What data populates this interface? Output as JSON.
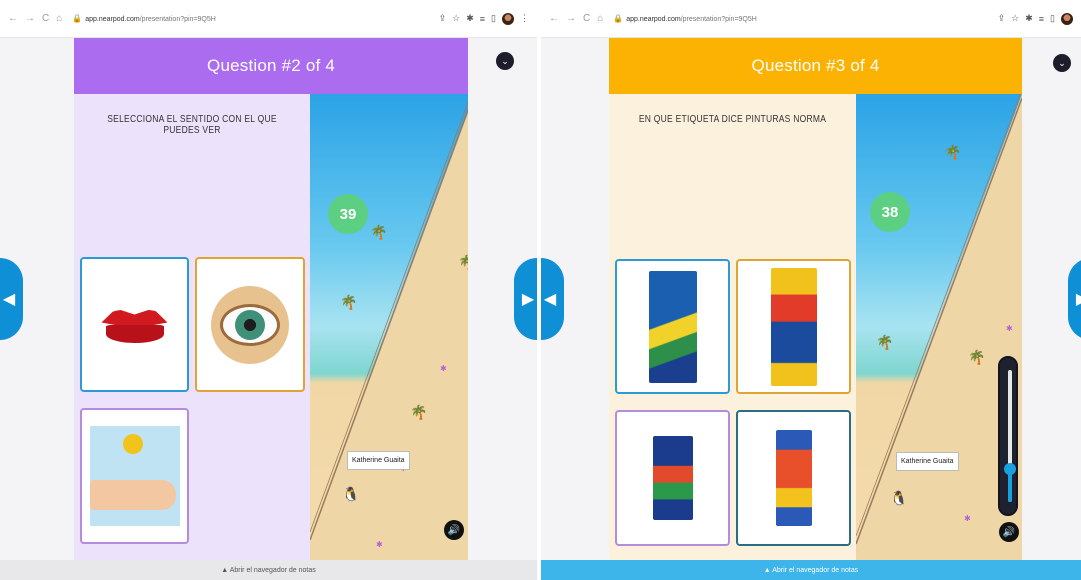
{
  "left_screen": {
    "browser": {
      "url_host": "app.nearpod.com",
      "url_path": "/presentation?pin=9Q5H"
    },
    "header": {
      "title": "Question #2 of 4",
      "color": "#ab6cf0"
    },
    "question": "SELECCIONA EL SENTIDO CON EL QUE PUEDES VER",
    "answers": [
      {
        "name": "lips-image",
        "border": "#2e9ad3"
      },
      {
        "name": "eye-image",
        "border": "#e0a434"
      },
      {
        "name": "hand-image",
        "border": "#b58bdc"
      }
    ],
    "game": {
      "timer": "39",
      "player": "Katherine Guaita"
    },
    "bottom_bar": "▲ Abrir el navegador de notas"
  },
  "right_screen": {
    "browser": {
      "url_host": "app.nearpod.com",
      "url_path": "/presentation?pin=9Q5H"
    },
    "header": {
      "title": "Question #3 of 4",
      "color": "#fbb203"
    },
    "question": "EN QUE ETIQUETA DICE PINTURAS NORMA",
    "answers": [
      {
        "name": "pencil-box-1-image",
        "border": "#2e9ad3"
      },
      {
        "name": "pencil-box-2-image",
        "border": "#e0a434"
      },
      {
        "name": "pencil-box-3-image",
        "border": "#b58bdc"
      },
      {
        "name": "pencil-box-4-image",
        "border": "#2a6e86"
      }
    ],
    "game": {
      "timer": "38",
      "player": "Katherine Guaita"
    },
    "volume_level": 0.25,
    "bottom_bar": "▲ Abrir el navegador de notas"
  }
}
